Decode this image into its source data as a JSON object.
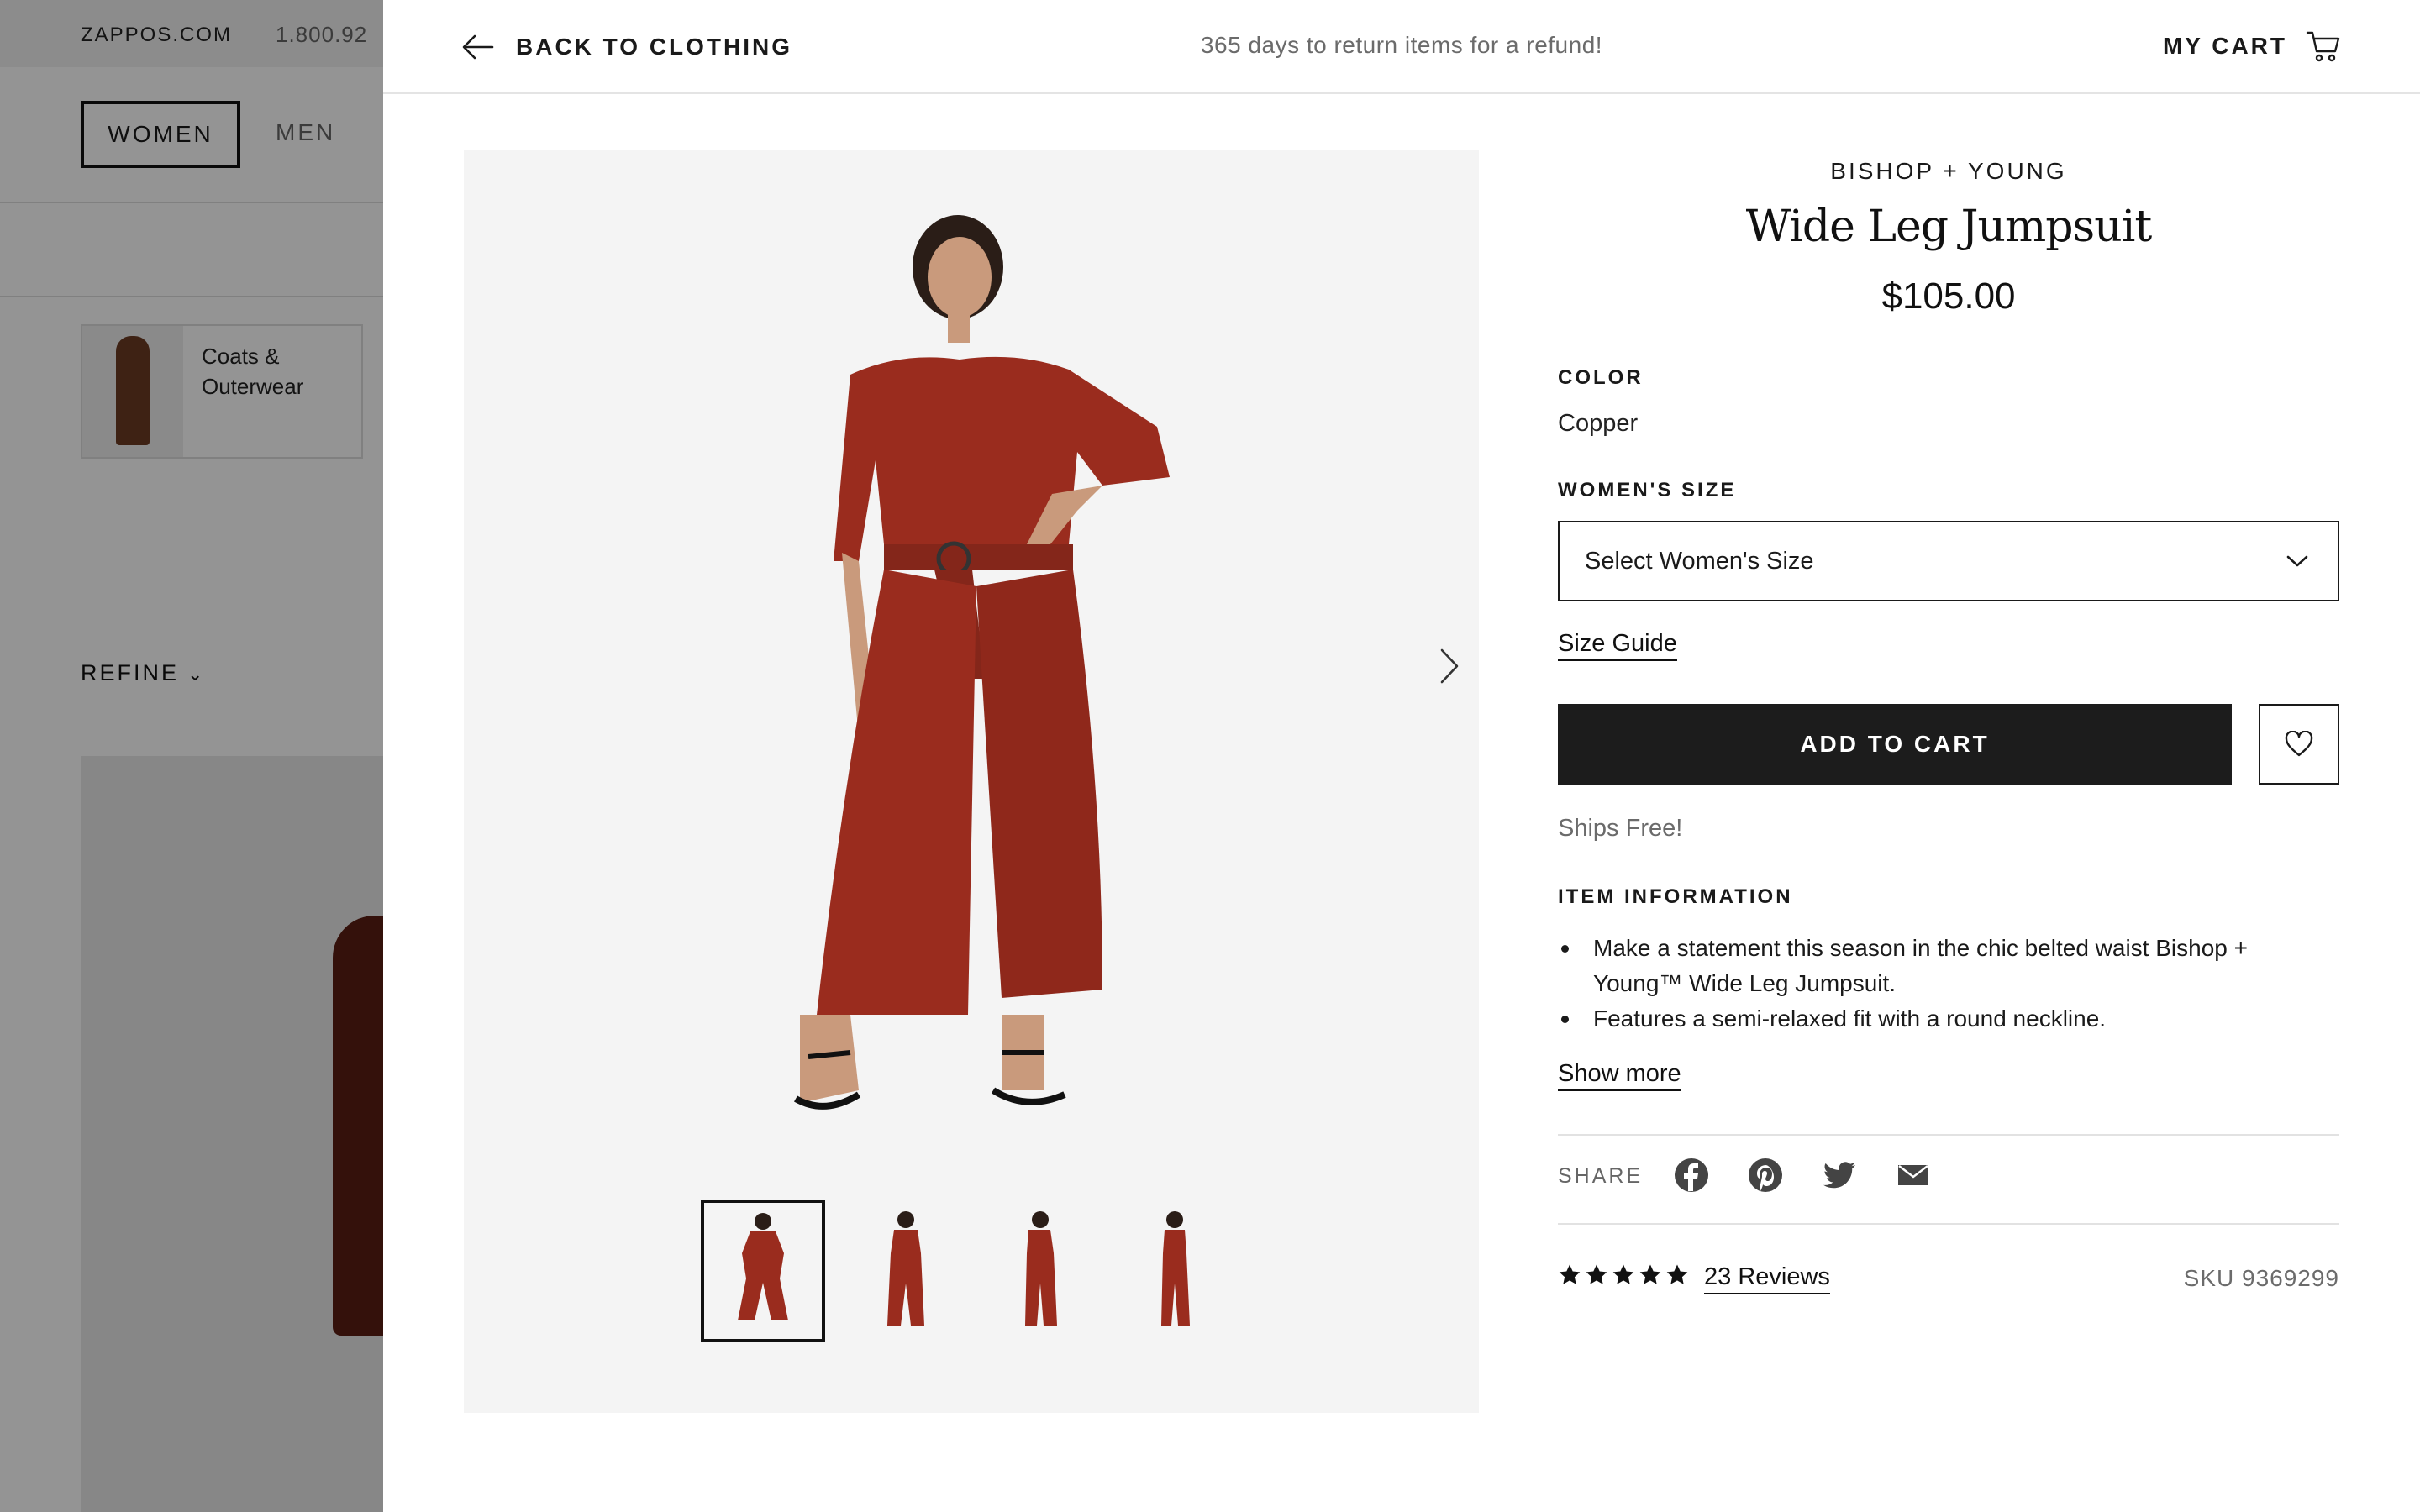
{
  "background": {
    "site_name": "ZAPPOS.COM",
    "phone": "1.800.92",
    "nav": {
      "women": "WOMEN",
      "men": "MEN"
    },
    "category_card": {
      "label": "Coats & Outerwear"
    },
    "refine_label": "REFINE"
  },
  "header": {
    "back_label": "BACK TO CLOTHING",
    "return_note": "365 days to return items for a refund!",
    "cart_label": "MY CART"
  },
  "product": {
    "brand": "BISHOP + YOUNG",
    "title": "Wide Leg Jumpsuit",
    "price": "$105.00",
    "color_label": "COLOR",
    "color_value": "Copper",
    "size_label": "WOMEN'S SIZE",
    "size_placeholder": "Select Women's Size",
    "size_guide": "Size Guide",
    "add_to_cart": "ADD TO CART",
    "shipping": "Ships Free!",
    "item_info_label": "ITEM INFORMATION",
    "bullets": [
      "Make a statement this season in the chic belted waist Bishop + Young™ Wide Leg Jumpsuit.",
      "Features a semi-relaxed fit with a round neckline."
    ],
    "show_more": "Show more",
    "share_label": "SHARE",
    "share_icons": [
      "facebook-icon",
      "pinterest-icon",
      "twitter-icon",
      "email-icon"
    ],
    "rating": 5,
    "reviews": "23 Reviews",
    "sku": "SKU 9369299",
    "gallery": {
      "thumbnail_count": 4,
      "active_index": 0
    },
    "colors": {
      "jumpsuit": "#9a2c1e",
      "button": "#1c1c1c",
      "gallery_bg": "#f4f4f4"
    }
  }
}
